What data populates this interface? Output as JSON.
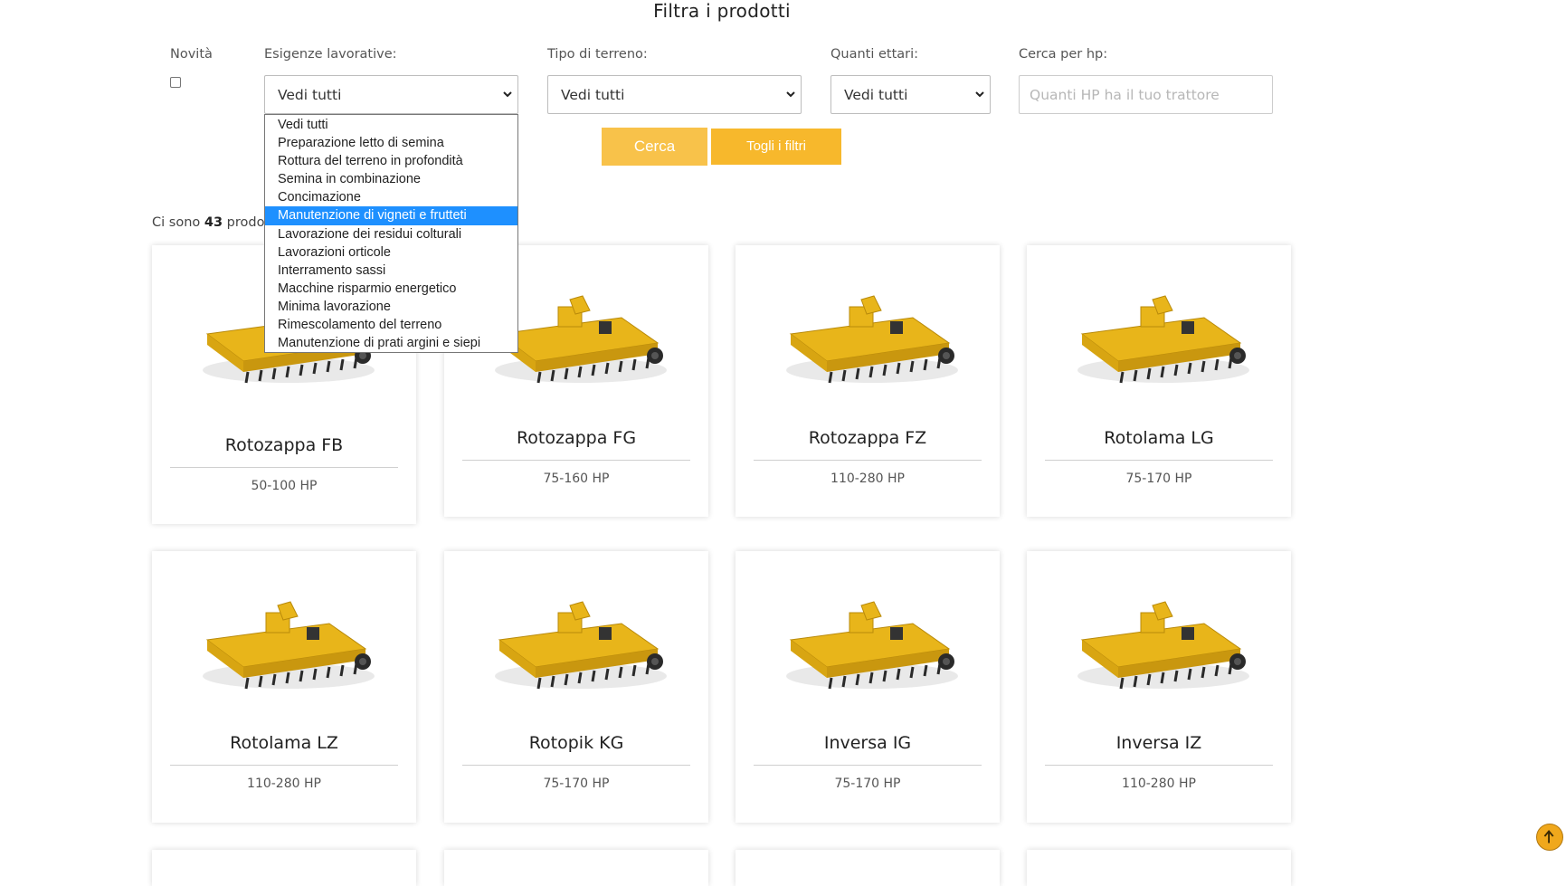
{
  "page_title": "Filtra i prodotti",
  "filters": {
    "novita": {
      "label": "Novità",
      "checked": false
    },
    "esigenze": {
      "label": "Esigenze lavorative:",
      "value": "Vedi tutti"
    },
    "terreno": {
      "label": "Tipo di terreno:",
      "value": "Vedi tutti"
    },
    "ettari": {
      "label": "Quanti ettari:",
      "value": "Vedi tutti"
    },
    "hp": {
      "label": "Cerca per hp:",
      "placeholder": "Quanti HP ha il tuo trattore"
    }
  },
  "buttons": {
    "search": "Cerca",
    "clear": "Togli i filtri"
  },
  "results": {
    "prefix": "Ci sono",
    "count": "43",
    "suffix": "prodot"
  },
  "dropdown": {
    "options": [
      "Vedi tutti",
      "Preparazione letto di semina",
      "Rottura del terreno in profondità",
      "Semina in combinazione",
      "Concimazione",
      "Manutenzione di vigneti e frutteti",
      "Lavorazione dei residui colturali",
      "Lavorazioni orticole",
      "Interramento sassi",
      "Macchine risparmio energetico",
      "Minima lavorazione",
      "Rimescolamento del terreno",
      "Manutenzione di prati argini e siepi"
    ],
    "selected_index": 5
  },
  "products": [
    {
      "name": "Rotozappa FB",
      "hp": "50-100 HP"
    },
    {
      "name": "Rotozappa FG",
      "hp": "75-160 HP"
    },
    {
      "name": "Rotozappa FZ",
      "hp": "110-280 HP"
    },
    {
      "name": "Rotolama LG",
      "hp": "75-170 HP"
    },
    {
      "name": "Rotolama LZ",
      "hp": "110-280 HP"
    },
    {
      "name": "Rotopik KG",
      "hp": "75-170 HP"
    },
    {
      "name": "Inversa IG",
      "hp": "75-170 HP"
    },
    {
      "name": "Inversa IZ",
      "hp": "110-280 HP"
    }
  ],
  "colors": {
    "accent": "#f7b82c",
    "accent_light": "#f8c24a",
    "highlight": "#1e90ff",
    "machine": "#e8b51a"
  }
}
